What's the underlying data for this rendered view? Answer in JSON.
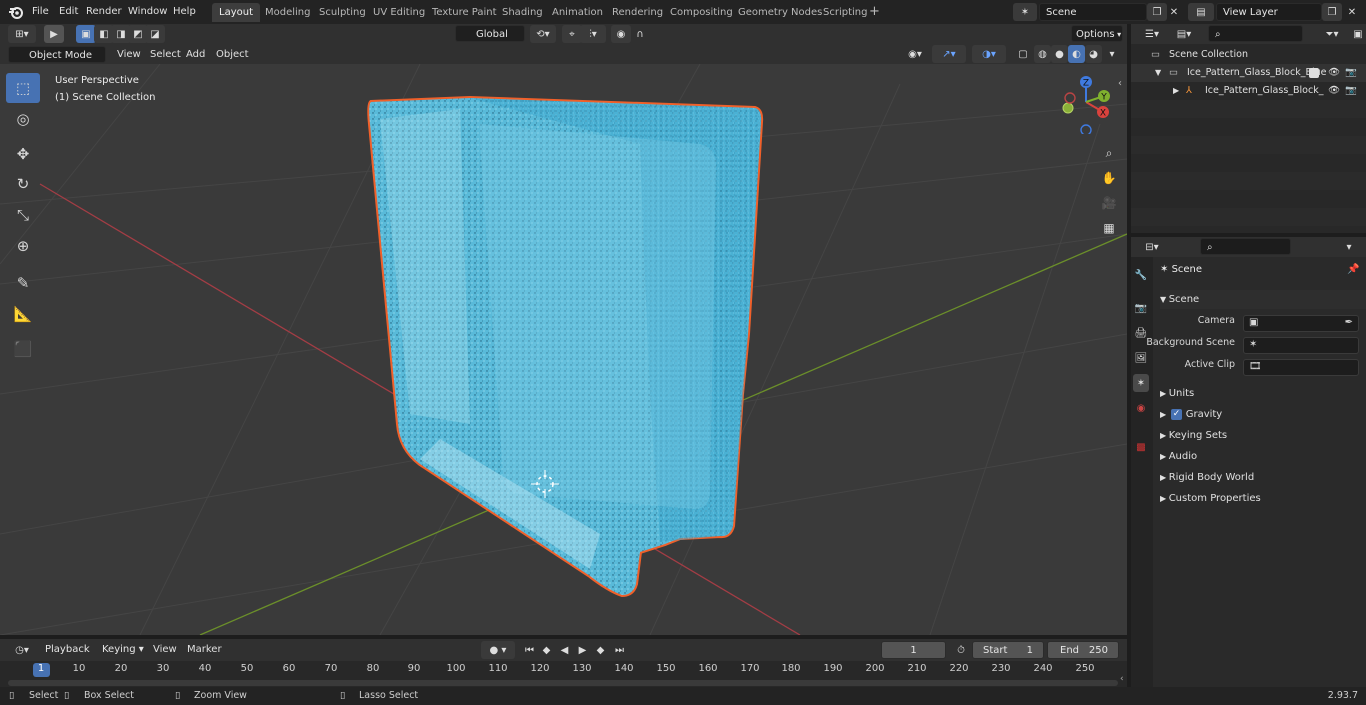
{
  "app_menu": [
    "File",
    "Edit",
    "Render",
    "Window",
    "Help"
  ],
  "workspaces": [
    "Layout",
    "Modeling",
    "Sculpting",
    "UV Editing",
    "Texture Paint",
    "Shading",
    "Animation",
    "Rendering",
    "Compositing",
    "Geometry Nodes",
    "Scripting"
  ],
  "active_workspace": "Layout",
  "scene_field": "Scene",
  "view_layer_field": "View Layer",
  "tool_header": {
    "orientation": "Global",
    "options": "Options"
  },
  "viewport_header": {
    "mode": "Object Mode",
    "menus": [
      "View",
      "Select",
      "Add",
      "Object"
    ]
  },
  "viewport": {
    "perspective_label": "User Perspective",
    "collection_label": "(1) Scene Collection",
    "accent_color": "#4772b3",
    "selection_color": "#f0602a",
    "object_color": "#58b9dc"
  },
  "outliner": {
    "root": "Scene Collection",
    "items": [
      "Ice_Pattern_Glass_Block_Blue",
      "Ice_Pattern_Glass_Block_"
    ]
  },
  "properties": {
    "header": "Scene",
    "panel": "Scene",
    "fields": [
      "Camera",
      "Background Scene",
      "Active Clip"
    ],
    "subpanels": [
      "Units",
      "Gravity",
      "Keying Sets",
      "Audio",
      "Rigid Body World",
      "Custom Properties"
    ],
    "gravity_checked": true
  },
  "timeline": {
    "menus": [
      "Playback",
      "Keying",
      "View",
      "Marker"
    ],
    "current_frame": "1",
    "start_label": "Start",
    "start_value": "1",
    "end_label": "End",
    "end_value": "250",
    "ruler": [
      "1",
      "10",
      "20",
      "30",
      "40",
      "50",
      "60",
      "70",
      "80",
      "90",
      "100",
      "110",
      "120",
      "130",
      "140",
      "150",
      "160",
      "170",
      "180",
      "190",
      "200",
      "210",
      "220",
      "230",
      "240",
      "250"
    ]
  },
  "status_bar": {
    "select": "Select",
    "box_select": "Box Select",
    "zoom_view": "Zoom View",
    "lasso_select": "Lasso Select",
    "version": "2.93.7"
  }
}
